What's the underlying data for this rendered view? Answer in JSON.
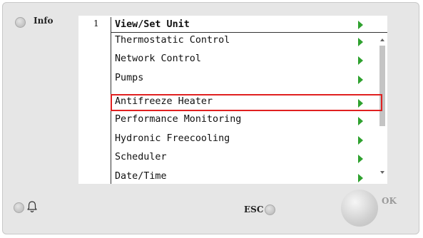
{
  "panel": {
    "info_label": "Info",
    "esc_label": "ESC",
    "ok_label": "OK"
  },
  "screen": {
    "page_number": "1",
    "title": "View/Set Unit",
    "items": [
      {
        "label": "Thermostatic Control"
      },
      {
        "label": "Network Control"
      },
      {
        "label": "Pumps"
      },
      {
        "label": "Antifreeze Heater",
        "highlighted": true
      },
      {
        "label": "Performance Monitoring"
      },
      {
        "label": "Hydronic Freecooling"
      },
      {
        "label": "Scheduler"
      },
      {
        "label": "Date/Time"
      }
    ]
  },
  "colors": {
    "arrow": "#2fa12f",
    "highlight_border": "#e02020"
  },
  "icons": [
    "bell-icon",
    "chevron-right-icon",
    "scroll-up-icon",
    "scroll-down-icon"
  ]
}
